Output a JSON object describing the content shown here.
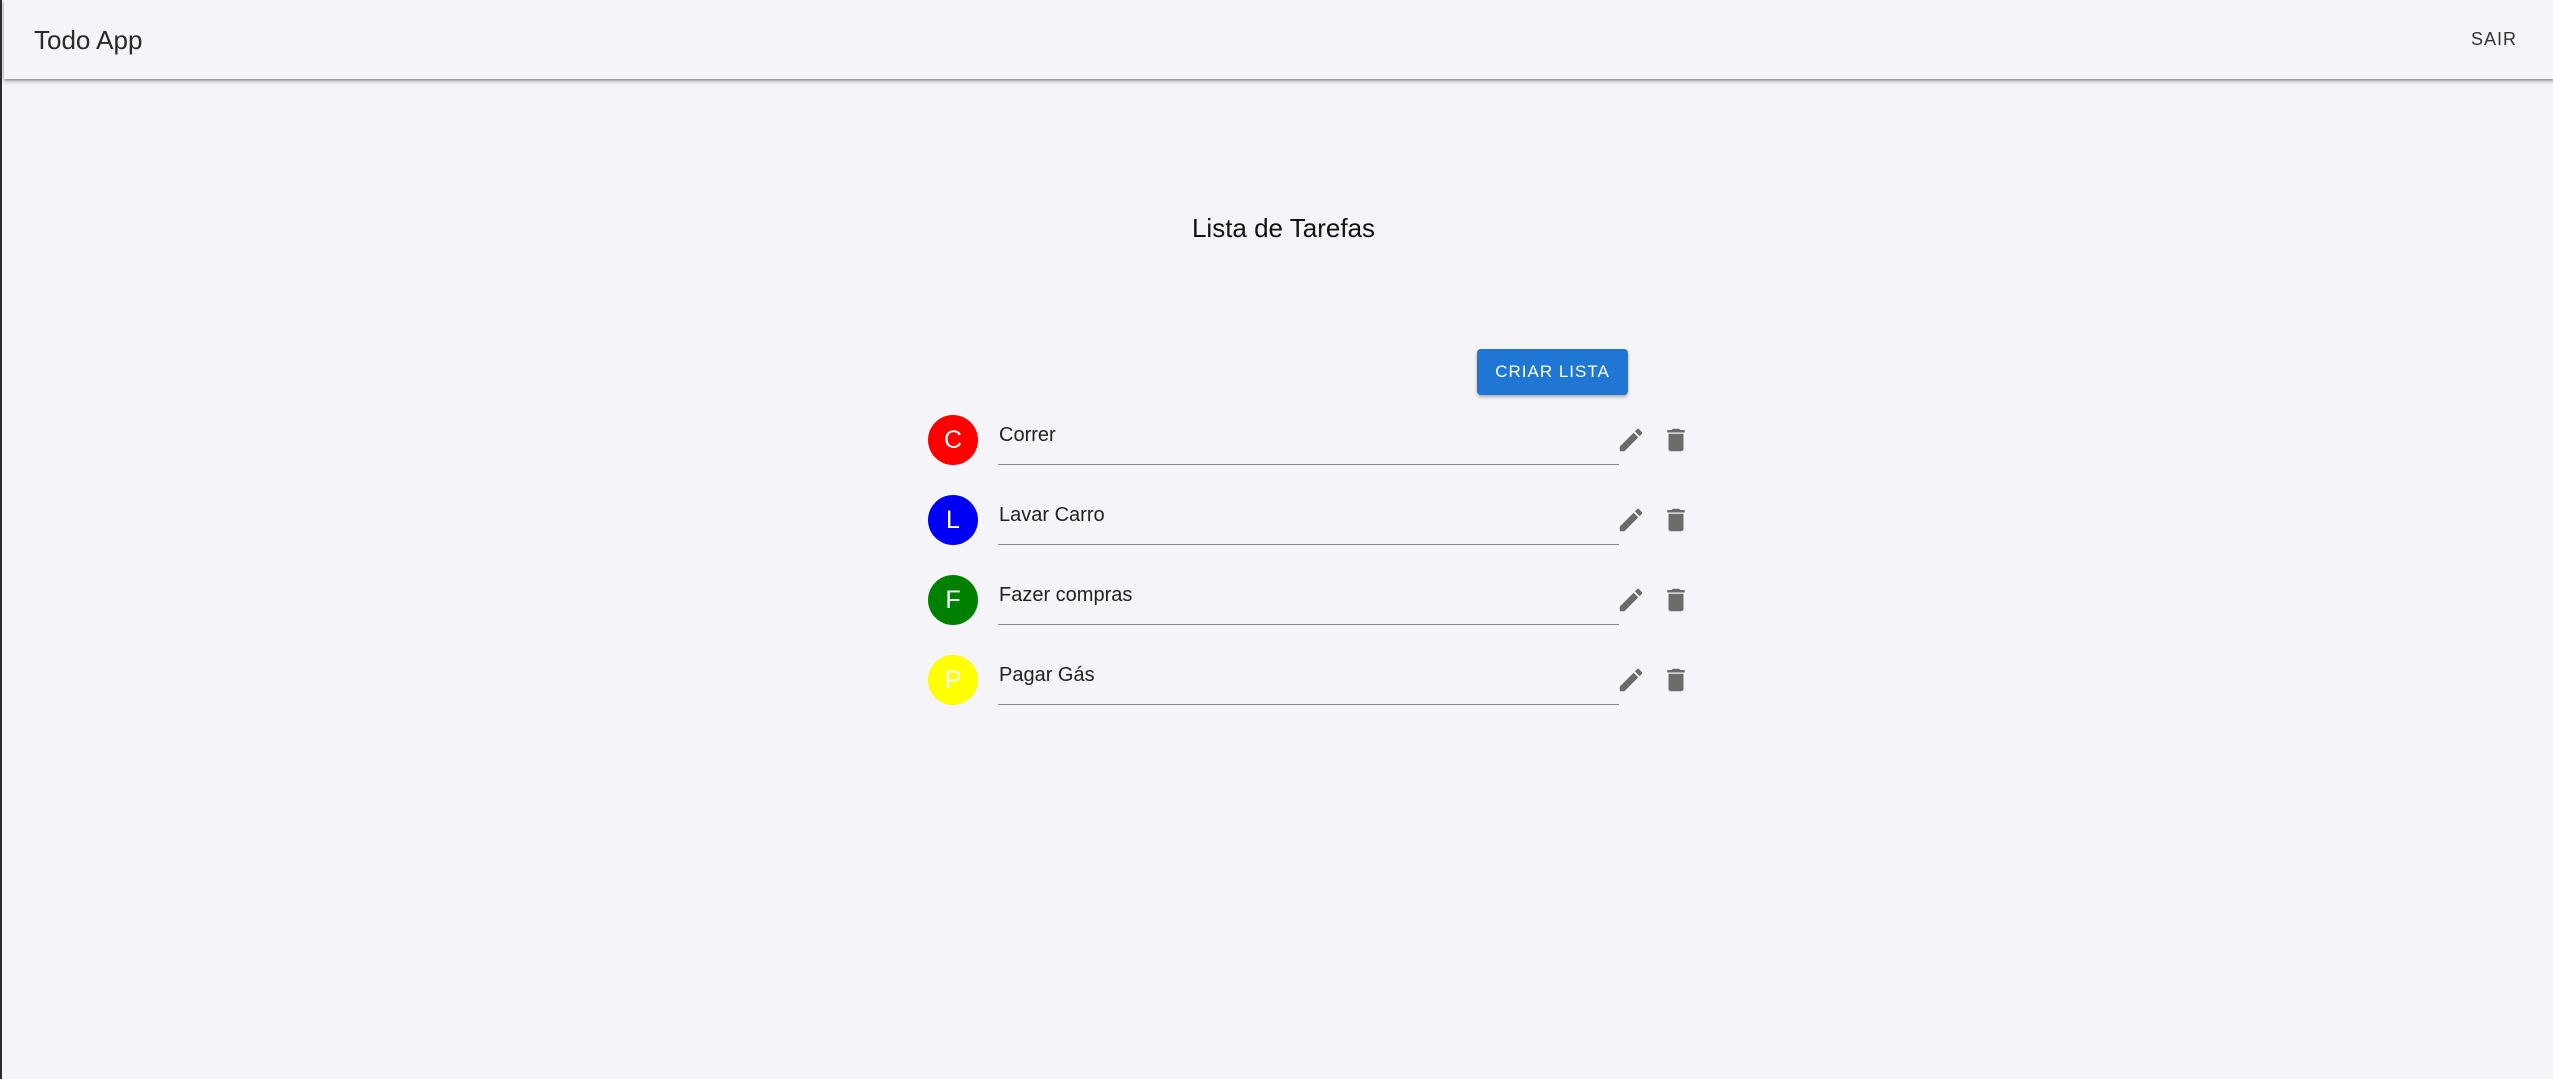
{
  "header": {
    "app_title": "Todo App",
    "logout_label": "SAIR"
  },
  "main": {
    "title": "Lista de Tarefas",
    "create_button_label": "CRIAR LISTA"
  },
  "todos": [
    {
      "initial": "C",
      "text": "Correr",
      "color": "#ff0000"
    },
    {
      "initial": "L",
      "text": "Lavar Carro",
      "color": "#0000f5"
    },
    {
      "initial": "F",
      "text": "Fazer compras",
      "color": "#008000"
    },
    {
      "initial": "P",
      "text": "Pagar Gás",
      "color": "#ffff00"
    }
  ],
  "icons": {
    "edit": "pencil-icon",
    "delete": "trash-icon"
  },
  "colors": {
    "accent": "#1f76d3",
    "background": "#f5f5f9",
    "icon": "#6b6b6b"
  }
}
